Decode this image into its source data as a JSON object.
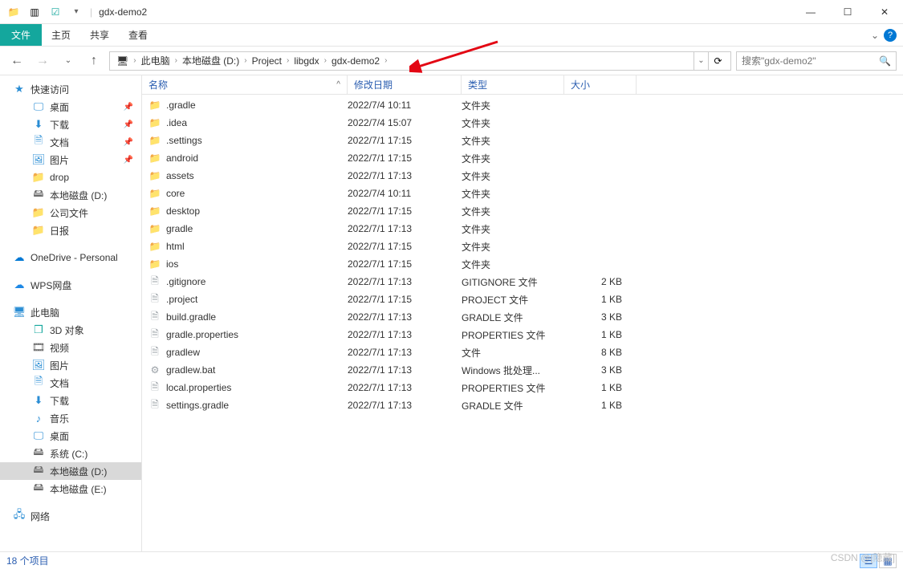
{
  "title": "gdx-demo2",
  "ribbon": {
    "file": "文件",
    "home": "主页",
    "share": "共享",
    "view": "查看"
  },
  "breadcrumb": [
    "此电脑",
    "本地磁盘 (D:)",
    "Project",
    "libgdx",
    "gdx-demo2"
  ],
  "search_placeholder": "搜索\"gdx-demo2\"",
  "columns": {
    "name": "名称",
    "date": "修改日期",
    "type": "类型",
    "size": "大小"
  },
  "sidebar": {
    "quick_access": "快速访问",
    "items_qa": [
      {
        "icon": "desktop",
        "label": "桌面",
        "pin": true
      },
      {
        "icon": "download",
        "label": "下载",
        "pin": true
      },
      {
        "icon": "doc",
        "label": "文档",
        "pin": true
      },
      {
        "icon": "pic",
        "label": "图片",
        "pin": true
      },
      {
        "icon": "folder",
        "label": "drop",
        "pin": false
      },
      {
        "icon": "drive",
        "label": "本地磁盘 (D:)",
        "pin": false
      },
      {
        "icon": "folder",
        "label": "公司文件",
        "pin": false
      },
      {
        "icon": "folder",
        "label": "日报",
        "pin": false
      }
    ],
    "onedrive": "OneDrive - Personal",
    "wps": "WPS网盘",
    "this_pc": "此电脑",
    "items_pc": [
      {
        "icon": "3d",
        "label": "3D 对象"
      },
      {
        "icon": "video",
        "label": "视频"
      },
      {
        "icon": "pic",
        "label": "图片"
      },
      {
        "icon": "doc",
        "label": "文档"
      },
      {
        "icon": "download",
        "label": "下载"
      },
      {
        "icon": "music",
        "label": "音乐"
      },
      {
        "icon": "desktop",
        "label": "桌面"
      },
      {
        "icon": "drive",
        "label": "系统 (C:)"
      },
      {
        "icon": "drive",
        "label": "本地磁盘 (D:)",
        "selected": true
      },
      {
        "icon": "drive",
        "label": "本地磁盘 (E:)"
      }
    ],
    "network": "网络"
  },
  "files": [
    {
      "icon": "folder",
      "name": ".gradle",
      "date": "2022/7/4 10:11",
      "type": "文件夹",
      "size": ""
    },
    {
      "icon": "folder",
      "name": ".idea",
      "date": "2022/7/4 15:07",
      "type": "文件夹",
      "size": ""
    },
    {
      "icon": "folder",
      "name": ".settings",
      "date": "2022/7/1 17:15",
      "type": "文件夹",
      "size": ""
    },
    {
      "icon": "folder",
      "name": "android",
      "date": "2022/7/1 17:15",
      "type": "文件夹",
      "size": ""
    },
    {
      "icon": "folder",
      "name": "assets",
      "date": "2022/7/1 17:13",
      "type": "文件夹",
      "size": ""
    },
    {
      "icon": "folder",
      "name": "core",
      "date": "2022/7/4 10:11",
      "type": "文件夹",
      "size": ""
    },
    {
      "icon": "folder",
      "name": "desktop",
      "date": "2022/7/1 17:15",
      "type": "文件夹",
      "size": ""
    },
    {
      "icon": "folder",
      "name": "gradle",
      "date": "2022/7/1 17:13",
      "type": "文件夹",
      "size": ""
    },
    {
      "icon": "folder",
      "name": "html",
      "date": "2022/7/1 17:15",
      "type": "文件夹",
      "size": ""
    },
    {
      "icon": "folder",
      "name": "ios",
      "date": "2022/7/1 17:15",
      "type": "文件夹",
      "size": ""
    },
    {
      "icon": "file",
      "name": ".gitignore",
      "date": "2022/7/1 17:13",
      "type": "GITIGNORE 文件",
      "size": "2 KB"
    },
    {
      "icon": "file",
      "name": ".project",
      "date": "2022/7/1 17:15",
      "type": "PROJECT 文件",
      "size": "1 KB"
    },
    {
      "icon": "file",
      "name": "build.gradle",
      "date": "2022/7/1 17:13",
      "type": "GRADLE 文件",
      "size": "3 KB"
    },
    {
      "icon": "file",
      "name": "gradle.properties",
      "date": "2022/7/1 17:13",
      "type": "PROPERTIES 文件",
      "size": "1 KB"
    },
    {
      "icon": "file",
      "name": "gradlew",
      "date": "2022/7/1 17:13",
      "type": "文件",
      "size": "8 KB"
    },
    {
      "icon": "bat",
      "name": "gradlew.bat",
      "date": "2022/7/1 17:13",
      "type": "Windows 批处理...",
      "size": "3 KB"
    },
    {
      "icon": "file",
      "name": "local.properties",
      "date": "2022/7/1 17:13",
      "type": "PROPERTIES 文件",
      "size": "1 KB"
    },
    {
      "icon": "file",
      "name": "settings.gradle",
      "date": "2022/7/1 17:13",
      "type": "GRADLE 文件",
      "size": "1 KB"
    }
  ],
  "status": "18 个项目",
  "watermark": "CSDN @[隐藏]"
}
